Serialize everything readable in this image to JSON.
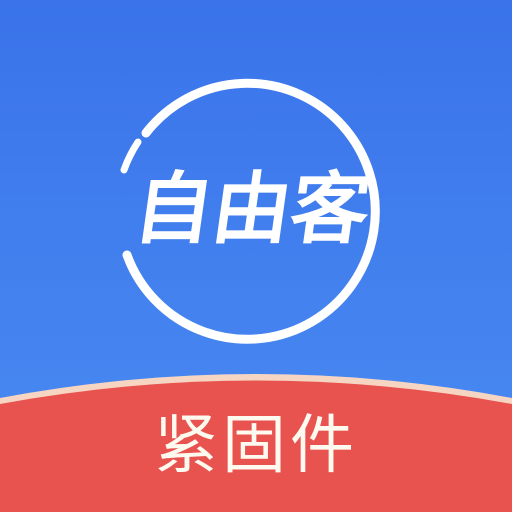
{
  "logo": {
    "wordmark": "自由客",
    "icon": "ring-logo-icon"
  },
  "banner": {
    "label": "紧固件"
  },
  "colors": {
    "background_top": "#3a73ea",
    "background_bottom": "#4a8cf2",
    "ring": "#ffffff",
    "wordmark": "#ffffff",
    "banner": "#e8524f",
    "banner_edge": "#f6d6c2",
    "banner_text": "#fffaf0"
  }
}
